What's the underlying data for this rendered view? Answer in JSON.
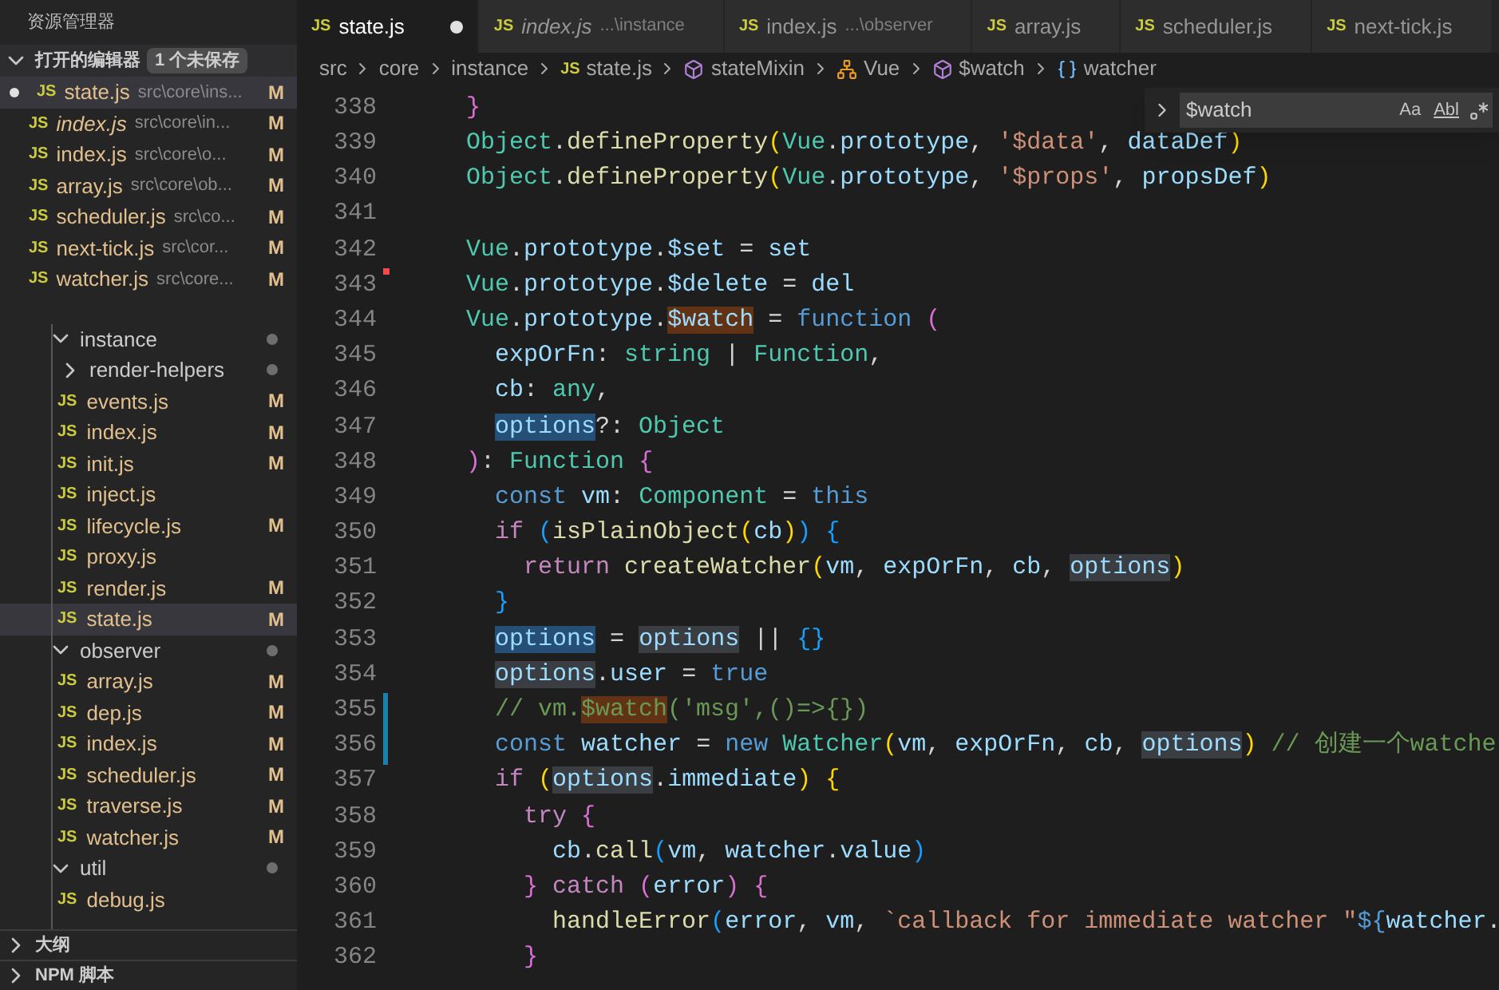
{
  "sidebar": {
    "title": "资源管理器",
    "open_editors": {
      "title": "打开的编辑器",
      "expanded": true,
      "badge": "1 个未保存",
      "items": [
        {
          "icon": "JS",
          "name": "state.js",
          "path": "src\\core\\ins...",
          "status": "M",
          "dirty": true,
          "italic": false,
          "selected": true
        },
        {
          "icon": "JS",
          "name": "index.js",
          "path": "src\\core\\in...",
          "status": "M",
          "dirty": false,
          "italic": true,
          "selected": false
        },
        {
          "icon": "JS",
          "name": "index.js",
          "path": "src\\core\\o...",
          "status": "M",
          "dirty": false,
          "italic": false,
          "selected": false
        },
        {
          "icon": "JS",
          "name": "array.js",
          "path": "src\\core\\ob...",
          "status": "M",
          "dirty": false,
          "italic": false,
          "selected": false
        },
        {
          "icon": "JS",
          "name": "scheduler.js",
          "path": "src\\co...",
          "status": "M",
          "dirty": false,
          "italic": false,
          "selected": false
        },
        {
          "icon": "JS",
          "name": "next-tick.js",
          "path": "src\\cor...",
          "status": "M",
          "dirty": false,
          "italic": false,
          "selected": false
        },
        {
          "icon": "JS",
          "name": "watcher.js",
          "path": "src\\core...",
          "status": "M",
          "dirty": false,
          "italic": false,
          "selected": false
        }
      ]
    },
    "tree": [
      {
        "kind": "folder",
        "name": "instance",
        "expanded": true,
        "dot": true,
        "children": [
          {
            "kind": "folder",
            "name": "render-helpers",
            "expanded": false,
            "dot": true
          },
          {
            "kind": "file",
            "icon": "JS",
            "name": "events.js",
            "status": "M",
            "selected": false
          },
          {
            "kind": "file",
            "icon": "JS",
            "name": "index.js",
            "status": "M",
            "selected": false
          },
          {
            "kind": "file",
            "icon": "JS",
            "name": "init.js",
            "status": "M",
            "selected": false
          },
          {
            "kind": "file",
            "icon": "JS",
            "name": "inject.js",
            "selected": false
          },
          {
            "kind": "file",
            "icon": "JS",
            "name": "lifecycle.js",
            "status": "M",
            "selected": false
          },
          {
            "kind": "file",
            "icon": "JS",
            "name": "proxy.js",
            "selected": false
          },
          {
            "kind": "file",
            "icon": "JS",
            "name": "render.js",
            "status": "M",
            "selected": false
          },
          {
            "kind": "file",
            "icon": "JS",
            "name": "state.js",
            "status": "M",
            "selected": true
          }
        ]
      },
      {
        "kind": "folder",
        "name": "observer",
        "expanded": true,
        "dot": true,
        "children": [
          {
            "kind": "file",
            "icon": "JS",
            "name": "array.js",
            "status": "M",
            "selected": false
          },
          {
            "kind": "file",
            "icon": "JS",
            "name": "dep.js",
            "status": "M",
            "selected": false
          },
          {
            "kind": "file",
            "icon": "JS",
            "name": "index.js",
            "status": "M",
            "selected": false
          },
          {
            "kind": "file",
            "icon": "JS",
            "name": "scheduler.js",
            "status": "M",
            "selected": false
          },
          {
            "kind": "file",
            "icon": "JS",
            "name": "traverse.js",
            "status": "M",
            "selected": false
          },
          {
            "kind": "file",
            "icon": "JS",
            "name": "watcher.js",
            "status": "M",
            "selected": false
          }
        ]
      },
      {
        "kind": "folder",
        "name": "util",
        "expanded": true,
        "dot": true,
        "children": [
          {
            "kind": "file",
            "icon": "JS",
            "name": "debug.js",
            "selected": false
          }
        ]
      }
    ],
    "panels": [
      {
        "title": "大纲",
        "expanded": false
      },
      {
        "title": "NPM 脚本",
        "expanded": false
      }
    ]
  },
  "tabs": [
    {
      "icon": "JS",
      "label": "state.js",
      "dirty": true,
      "italic": false,
      "selected": true
    },
    {
      "icon": "JS",
      "label": "index.js",
      "detail": "...\\instance",
      "dirty": false,
      "italic": true,
      "selected": false
    },
    {
      "icon": "JS",
      "label": "index.js",
      "detail": "...\\observer",
      "dirty": false,
      "italic": false,
      "selected": false
    },
    {
      "icon": "JS",
      "label": "array.js",
      "dirty": false,
      "italic": false,
      "selected": false
    },
    {
      "icon": "JS",
      "label": "scheduler.js",
      "dirty": false,
      "italic": false,
      "selected": false
    },
    {
      "icon": "JS",
      "label": "next-tick.js",
      "dirty": false,
      "italic": false,
      "selected": false
    }
  ],
  "breadcrumbs": [
    {
      "kind": "folder",
      "label": "src"
    },
    {
      "kind": "folder",
      "label": "core"
    },
    {
      "kind": "folder",
      "label": "instance"
    },
    {
      "kind": "file",
      "icon": "JS",
      "label": "state.js"
    },
    {
      "kind": "method",
      "label": "stateMixin"
    },
    {
      "kind": "class",
      "label": "Vue"
    },
    {
      "kind": "method",
      "label": "$watch"
    },
    {
      "kind": "variable",
      "label": "watcher"
    }
  ],
  "find_widget": {
    "value": "$watch",
    "options": [
      {
        "label": "Aa",
        "on": false
      },
      {
        "label": "Abl",
        "on": false
      }
    ]
  },
  "code_lines": [
    {
      "number": "338",
      "tokens": [
        {
          "text": "  }",
          "kind": "pink"
        }
      ]
    },
    {
      "number": "339",
      "tokens": [
        {
          "text": "  Object",
          "kind": "type"
        },
        {
          "text": "."
        },
        {
          "text": "defineProperty",
          "kind": "fn"
        },
        {
          "text": "(",
          "kind": "gold"
        },
        {
          "text": "Vue",
          "kind": "type"
        },
        {
          "text": "."
        },
        {
          "text": "prototype",
          "kind": "var"
        },
        {
          "text": ", "
        },
        {
          "text": "'$data'",
          "kind": "str"
        },
        {
          "text": ", "
        },
        {
          "text": "dataDef",
          "kind": "var"
        },
        {
          "text": ")",
          "kind": "gold"
        }
      ]
    },
    {
      "number": "340",
      "tokens": [
        {
          "text": "  Object",
          "kind": "type"
        },
        {
          "text": "."
        },
        {
          "text": "defineProperty",
          "kind": "fn"
        },
        {
          "text": "(",
          "kind": "gold"
        },
        {
          "text": "Vue",
          "kind": "type"
        },
        {
          "text": "."
        },
        {
          "text": "prototype",
          "kind": "var"
        },
        {
          "text": ", "
        },
        {
          "text": "'$props'",
          "kind": "str"
        },
        {
          "text": ", "
        },
        {
          "text": "propsDef",
          "kind": "var"
        },
        {
          "text": ")",
          "kind": "gold"
        }
      ]
    },
    {
      "number": "341"
    },
    {
      "number": "342",
      "tokens": [
        {
          "text": "  Vue",
          "kind": "type"
        },
        {
          "text": "."
        },
        {
          "text": "prototype",
          "kind": "var"
        },
        {
          "text": "."
        },
        {
          "text": "$set",
          "kind": "var"
        },
        {
          "text": " = "
        },
        {
          "text": "set",
          "kind": "var"
        }
      ]
    },
    {
      "number": "343",
      "deleted_marker": true,
      "tokens": [
        {
          "text": "  Vue",
          "kind": "type"
        },
        {
          "text": "."
        },
        {
          "text": "prototype",
          "kind": "var"
        },
        {
          "text": "."
        },
        {
          "text": "$delete",
          "kind": "var"
        },
        {
          "text": " = "
        },
        {
          "text": "del",
          "kind": "var"
        }
      ]
    },
    {
      "number": "344",
      "tokens": [
        {
          "text": "  Vue",
          "kind": "type"
        },
        {
          "text": "."
        },
        {
          "text": "prototype",
          "kind": "var"
        },
        {
          "text": "."
        },
        {
          "text": "$watch",
          "kind": "var",
          "search_match": true
        },
        {
          "text": " = "
        },
        {
          "text": "function ",
          "kind": "kw"
        },
        {
          "text": "(",
          "kind": "pink"
        }
      ]
    },
    {
      "number": "345",
      "tokens": [
        {
          "text": "    expOrFn",
          "kind": "var"
        },
        {
          "text": ": "
        },
        {
          "text": "string",
          "kind": "type"
        },
        {
          "text": " | "
        },
        {
          "text": "Function",
          "kind": "type"
        },
        {
          "text": ","
        }
      ]
    },
    {
      "number": "346",
      "tokens": [
        {
          "text": "    cb",
          "kind": "var"
        },
        {
          "text": ": "
        },
        {
          "text": "any",
          "kind": "type"
        },
        {
          "text": ","
        }
      ]
    },
    {
      "number": "347",
      "tokens": [
        {
          "text": "    options",
          "kind": "var",
          "text_selected": true
        },
        {
          "text": "?: "
        },
        {
          "text": "Object",
          "kind": "type"
        }
      ]
    },
    {
      "number": "348",
      "tokens": [
        {
          "text": "  )",
          "kind": "pink"
        },
        {
          "text": ": "
        },
        {
          "text": "Function ",
          "kind": "type"
        },
        {
          "text": "{",
          "kind": "pink"
        }
      ]
    },
    {
      "number": "349",
      "tokens": [
        {
          "text": "    const ",
          "kind": "kw"
        },
        {
          "text": "vm",
          "kind": "var"
        },
        {
          "text": ": "
        },
        {
          "text": "Component",
          "kind": "type"
        },
        {
          "text": " = "
        },
        {
          "text": "this",
          "kind": "kw"
        }
      ]
    },
    {
      "number": "350",
      "tokens": [
        {
          "text": "    if ",
          "kind": "ctrl"
        },
        {
          "text": "(",
          "kind": "blue"
        },
        {
          "text": "isPlainObject",
          "kind": "fn"
        },
        {
          "text": "(",
          "kind": "gold"
        },
        {
          "text": "cb",
          "kind": "var"
        },
        {
          "text": ")",
          "kind": "gold"
        },
        {
          "text": ") {",
          "kind": "blue"
        }
      ]
    },
    {
      "number": "351",
      "tokens": [
        {
          "text": "      return ",
          "kind": "ctrl"
        },
        {
          "text": "createWatcher",
          "kind": "fn"
        },
        {
          "text": "(",
          "kind": "gold"
        },
        {
          "text": "vm",
          "kind": "var"
        },
        {
          "text": ", "
        },
        {
          "text": "expOrFn",
          "kind": "var"
        },
        {
          "text": ", "
        },
        {
          "text": "cb",
          "kind": "var"
        },
        {
          "text": ", "
        },
        {
          "text": "options",
          "kind": "var",
          "occurrence": true
        },
        {
          "text": ")",
          "kind": "gold"
        }
      ]
    },
    {
      "number": "352",
      "tokens": [
        {
          "text": "    }",
          "kind": "blue"
        }
      ]
    },
    {
      "number": "353",
      "tokens": [
        {
          "text": "    options",
          "kind": "var",
          "text_selected": true
        },
        {
          "text": " = "
        },
        {
          "text": "options",
          "kind": "var",
          "occurrence": true
        },
        {
          "text": " || "
        },
        {
          "text": "{}",
          "kind": "blue"
        }
      ]
    },
    {
      "number": "354",
      "tokens": [
        {
          "text": "    options",
          "kind": "var",
          "occurrence": true
        },
        {
          "text": "."
        },
        {
          "text": "user",
          "kind": "var"
        },
        {
          "text": " = "
        },
        {
          "text": "true",
          "kind": "kw"
        }
      ]
    },
    {
      "number": "355",
      "modified_marker": true,
      "tokens": [
        {
          "text": "    // vm.",
          "kind": "comment"
        },
        {
          "text": "$watch",
          "kind": "comment",
          "search_match": true
        },
        {
          "text": "('msg',()=>{})",
          "kind": "comment"
        }
      ]
    },
    {
      "number": "356",
      "modified_marker": true,
      "tokens": [
        {
          "text": "    const ",
          "kind": "kw"
        },
        {
          "text": "watcher",
          "kind": "var"
        },
        {
          "text": " = "
        },
        {
          "text": "new ",
          "kind": "kw"
        },
        {
          "text": "Watcher",
          "kind": "type"
        },
        {
          "text": "(",
          "kind": "gold"
        },
        {
          "text": "vm",
          "kind": "var"
        },
        {
          "text": ", "
        },
        {
          "text": "expOrFn",
          "kind": "var"
        },
        {
          "text": ", "
        },
        {
          "text": "cb",
          "kind": "var"
        },
        {
          "text": ", "
        },
        {
          "text": "options",
          "kind": "var",
          "occurrence": true
        },
        {
          "text": ")",
          "kind": "gold"
        },
        {
          "text": " // 创建一个watche",
          "kind": "comment"
        }
      ]
    },
    {
      "number": "357",
      "tokens": [
        {
          "text": "    if ",
          "kind": "ctrl"
        },
        {
          "text": "(",
          "kind": "gold"
        },
        {
          "text": "options",
          "kind": "var",
          "occurrence": true
        },
        {
          "text": "."
        },
        {
          "text": "immediate",
          "kind": "var"
        },
        {
          "text": ") {",
          "kind": "gold"
        }
      ]
    },
    {
      "number": "358",
      "tokens": [
        {
          "text": "      try ",
          "kind": "ctrl"
        },
        {
          "text": "{",
          "kind": "pink"
        }
      ]
    },
    {
      "number": "359",
      "tokens": [
        {
          "text": "        cb",
          "kind": "var"
        },
        {
          "text": "."
        },
        {
          "text": "call",
          "kind": "fn"
        },
        {
          "text": "(",
          "kind": "blue"
        },
        {
          "text": "vm",
          "kind": "var"
        },
        {
          "text": ", "
        },
        {
          "text": "watcher",
          "kind": "var"
        },
        {
          "text": "."
        },
        {
          "text": "value",
          "kind": "var"
        },
        {
          "text": ")",
          "kind": "blue"
        }
      ]
    },
    {
      "number": "360",
      "tokens": [
        {
          "text": "      } ",
          "kind": "pink"
        },
        {
          "text": "catch ",
          "kind": "ctrl"
        },
        {
          "text": "(",
          "kind": "pink"
        },
        {
          "text": "error",
          "kind": "var"
        },
        {
          "text": ") {",
          "kind": "pink"
        }
      ]
    },
    {
      "number": "361",
      "tokens": [
        {
          "text": "        handleError",
          "kind": "fn"
        },
        {
          "text": "(",
          "kind": "blue"
        },
        {
          "text": "error",
          "kind": "var"
        },
        {
          "text": ", "
        },
        {
          "text": "vm",
          "kind": "var"
        },
        {
          "text": ", "
        },
        {
          "text": "`callback for immediate watcher \"",
          "kind": "str"
        },
        {
          "text": "${",
          "kind": "kw"
        },
        {
          "text": "watcher",
          "kind": "var"
        },
        {
          "text": "."
        }
      ]
    },
    {
      "number": "362",
      "tokens": [
        {
          "text": "      }",
          "kind": "pink"
        }
      ]
    }
  ]
}
